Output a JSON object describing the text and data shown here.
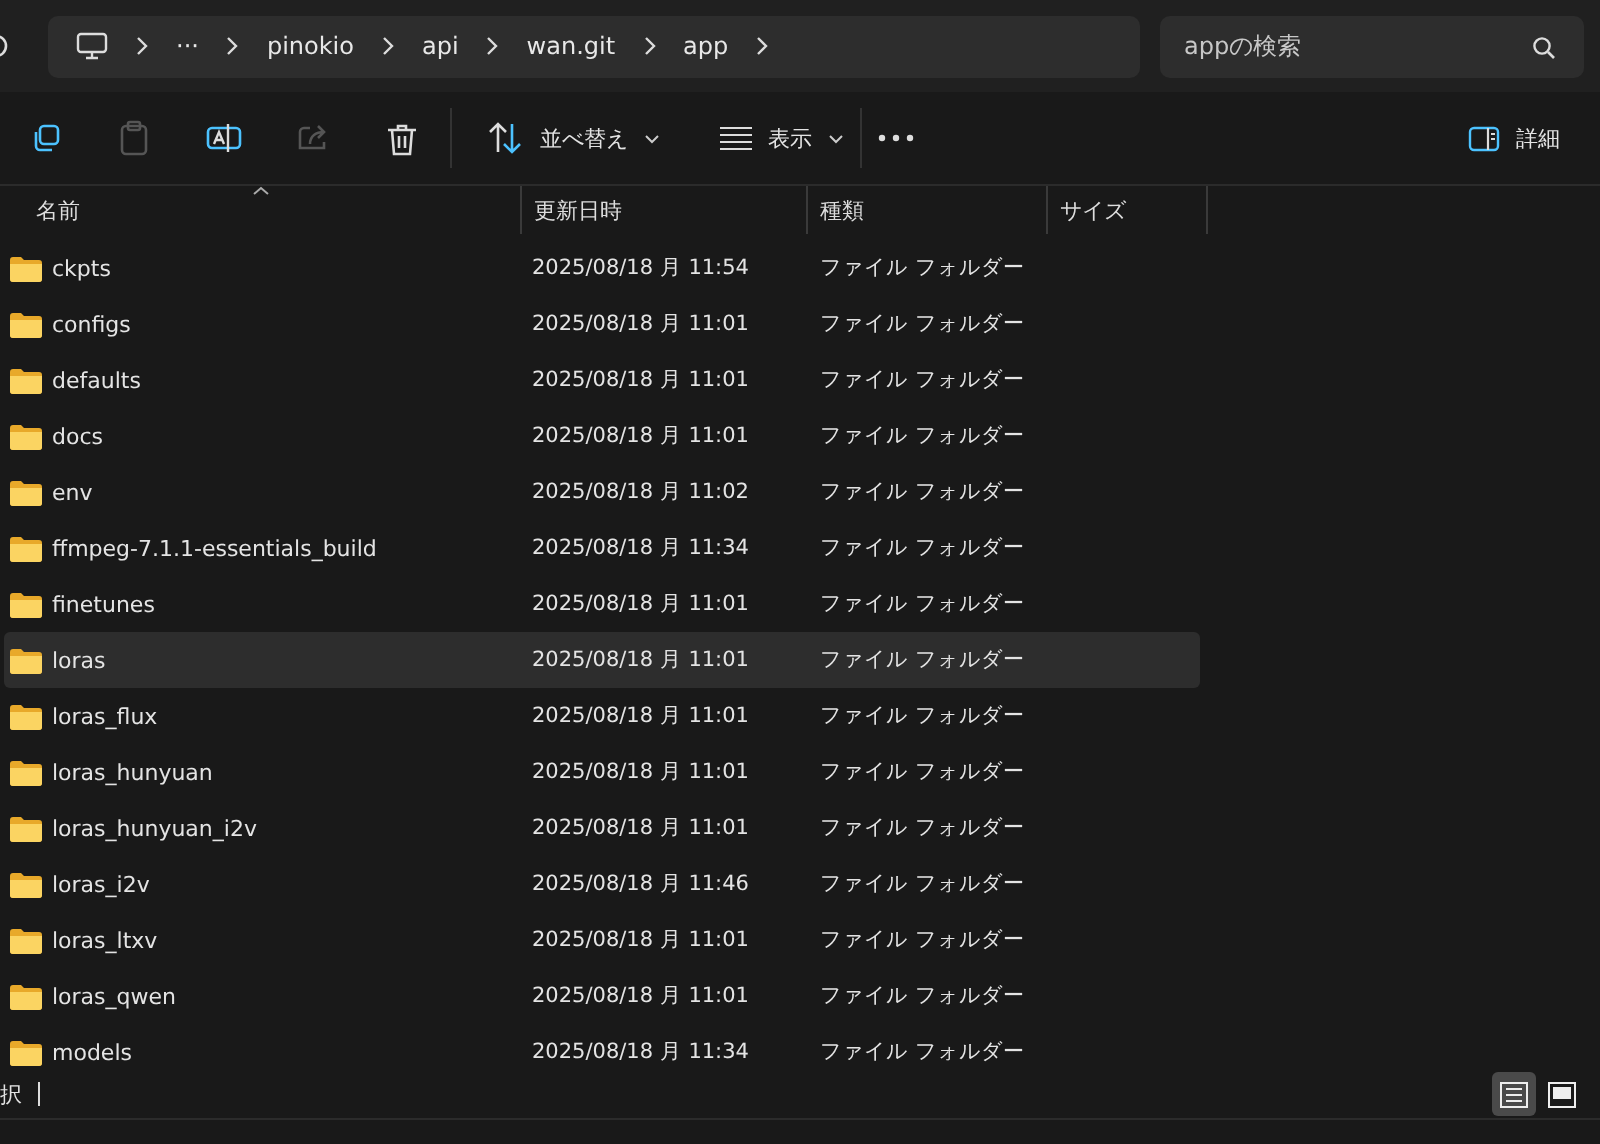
{
  "breadcrumbs": [
    {
      "kind": "icon"
    },
    {
      "kind": "more",
      "label": "···"
    },
    {
      "kind": "text",
      "label": "pinokio"
    },
    {
      "kind": "text",
      "label": "api"
    },
    {
      "kind": "text",
      "label": "wan.git"
    },
    {
      "kind": "text",
      "label": "app"
    }
  ],
  "search": {
    "placeholder": "appの検索"
  },
  "toolbar": {
    "sort": "並べ替え",
    "view": "表示",
    "details": "詳細"
  },
  "columns": [
    {
      "label": "名前",
      "sorted": true
    },
    {
      "label": "更新日時",
      "sorted": false
    },
    {
      "label": "種類",
      "sorted": false
    },
    {
      "label": "サイズ",
      "sorted": false
    }
  ],
  "rows": [
    {
      "name": "ckpts",
      "date": "2025/08/18 月 11:54",
      "type": "ファイル フォルダー",
      "selected": false
    },
    {
      "name": "configs",
      "date": "2025/08/18 月 11:01",
      "type": "ファイル フォルダー",
      "selected": false
    },
    {
      "name": "defaults",
      "date": "2025/08/18 月 11:01",
      "type": "ファイル フォルダー",
      "selected": false
    },
    {
      "name": "docs",
      "date": "2025/08/18 月 11:01",
      "type": "ファイル フォルダー",
      "selected": false
    },
    {
      "name": "env",
      "date": "2025/08/18 月 11:02",
      "type": "ファイル フォルダー",
      "selected": false
    },
    {
      "name": "ffmpeg-7.1.1-essentials_build",
      "date": "2025/08/18 月 11:34",
      "type": "ファイル フォルダー",
      "selected": false
    },
    {
      "name": "finetunes",
      "date": "2025/08/18 月 11:01",
      "type": "ファイル フォルダー",
      "selected": false
    },
    {
      "name": "loras",
      "date": "2025/08/18 月 11:01",
      "type": "ファイル フォルダー",
      "selected": true
    },
    {
      "name": "loras_flux",
      "date": "2025/08/18 月 11:01",
      "type": "ファイル フォルダー",
      "selected": false
    },
    {
      "name": "loras_hunyuan",
      "date": "2025/08/18 月 11:01",
      "type": "ファイル フォルダー",
      "selected": false
    },
    {
      "name": "loras_hunyuan_i2v",
      "date": "2025/08/18 月 11:01",
      "type": "ファイル フォルダー",
      "selected": false
    },
    {
      "name": "loras_i2v",
      "date": "2025/08/18 月 11:46",
      "type": "ファイル フォルダー",
      "selected": false
    },
    {
      "name": "loras_ltxv",
      "date": "2025/08/18 月 11:01",
      "type": "ファイル フォルダー",
      "selected": false
    },
    {
      "name": "loras_qwen",
      "date": "2025/08/18 月 11:01",
      "type": "ファイル フォルダー",
      "selected": false
    },
    {
      "name": "models",
      "date": "2025/08/18 月 11:34",
      "type": "ファイル フォルダー",
      "selected": false
    }
  ],
  "status_bar": {
    "text": "択",
    "views": [
      {
        "kind": "details",
        "selected": true
      },
      {
        "kind": "tiles",
        "selected": false
      }
    ]
  }
}
